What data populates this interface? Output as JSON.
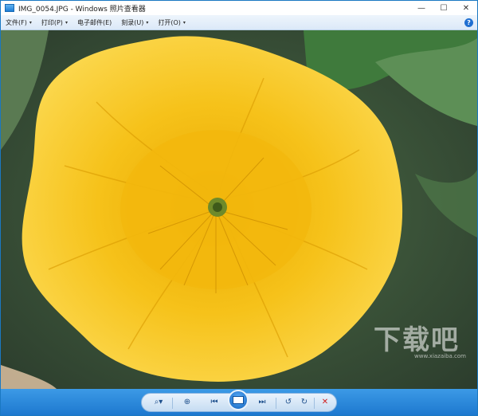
{
  "window": {
    "title": "IMG_0054.JPG - Windows 照片查看器",
    "buttons": {
      "minimize": "—",
      "maximize": "☐",
      "close": "✕"
    }
  },
  "menubar": {
    "items": [
      {
        "label": "文件(F)",
        "arrow": "▾"
      },
      {
        "label": "打印(P)",
        "arrow": "▾"
      },
      {
        "label": "电子邮件(E)",
        "arrow": ""
      },
      {
        "label": "刻录(U)",
        "arrow": "▾"
      },
      {
        "label": "打开(O)",
        "arrow": "▾"
      }
    ],
    "help": "?"
  },
  "toolbar": {
    "zoom": "⌕▾",
    "fit": "⊕",
    "prev": "⏮",
    "next": "⏭",
    "rotate_ccw": "↺",
    "rotate_cw": "↻",
    "delete": "✕"
  },
  "watermark": {
    "text": "下载吧",
    "url": "www.xiazaiba.com"
  }
}
